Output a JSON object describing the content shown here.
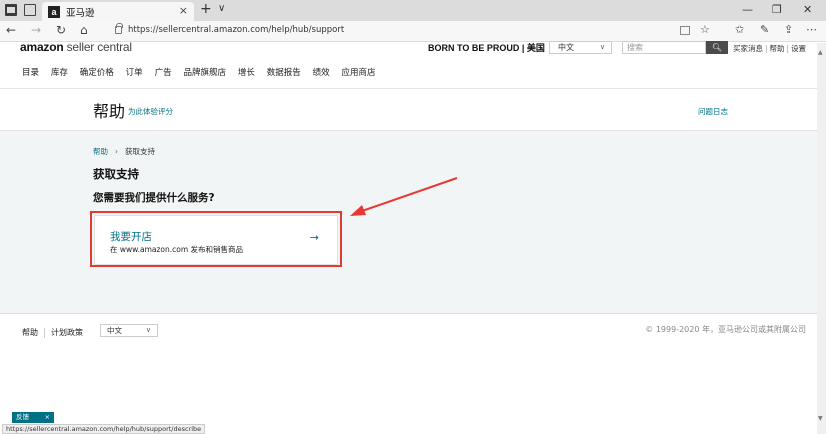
{
  "browser": {
    "tab_title": "亚马逊",
    "tab_favicon": "a",
    "tab_close": "×",
    "new_tab": "+",
    "tab_menu": "∨",
    "url": "https://sellercentral.amazon.com/help/hub/support",
    "nav_icons": [
      "back-icon",
      "forward-icon",
      "refresh-icon",
      "home-icon"
    ],
    "toolbar_icons": [
      "reading-view-icon",
      "favorite-star-icon",
      "favorites-icon",
      "notes-icon",
      "share-icon",
      "more-icon"
    ],
    "window_controls": [
      "minimize-icon",
      "restore-icon",
      "close-icon"
    ]
  },
  "header": {
    "logo_bold": "amazon",
    "logo_rest": " seller central",
    "banner": "BORN TO BE PROUD | 美国",
    "language": "中文",
    "search_placeholder": "搜索",
    "top_links": [
      "买家消息",
      "帮助",
      "设置"
    ]
  },
  "nav": {
    "items": [
      "目录",
      "库存",
      "确定价格",
      "订单",
      "广告",
      "品牌旗舰店",
      "增长",
      "数据报告",
      "绩效",
      "应用商店"
    ]
  },
  "help_header": {
    "title": "帮助",
    "rate_link": "为此体验评分",
    "case_log": "问题日志"
  },
  "main": {
    "breadcrumb": [
      "帮助",
      "获取支持"
    ],
    "title": "获取支持",
    "question": "您需要我们提供什么服务?",
    "card": {
      "title": "我要开店",
      "subtitle": "在 www.amazon.com 发布和销售商品",
      "arrow": "→"
    }
  },
  "annotation": {
    "color": "#e53935"
  },
  "footer": {
    "links": [
      "帮助",
      "计划政策"
    ],
    "language": "中文",
    "copyright": "© 1999-2020 年，亚马逊公司或其附属公司"
  },
  "feedback": {
    "label": "反馈",
    "close": "×"
  },
  "status_url": "https://sellercentral.amazon.com/help/hub/support/describe",
  "colors": {
    "link": "#007185",
    "content_bg": "#f2f5f5"
  }
}
